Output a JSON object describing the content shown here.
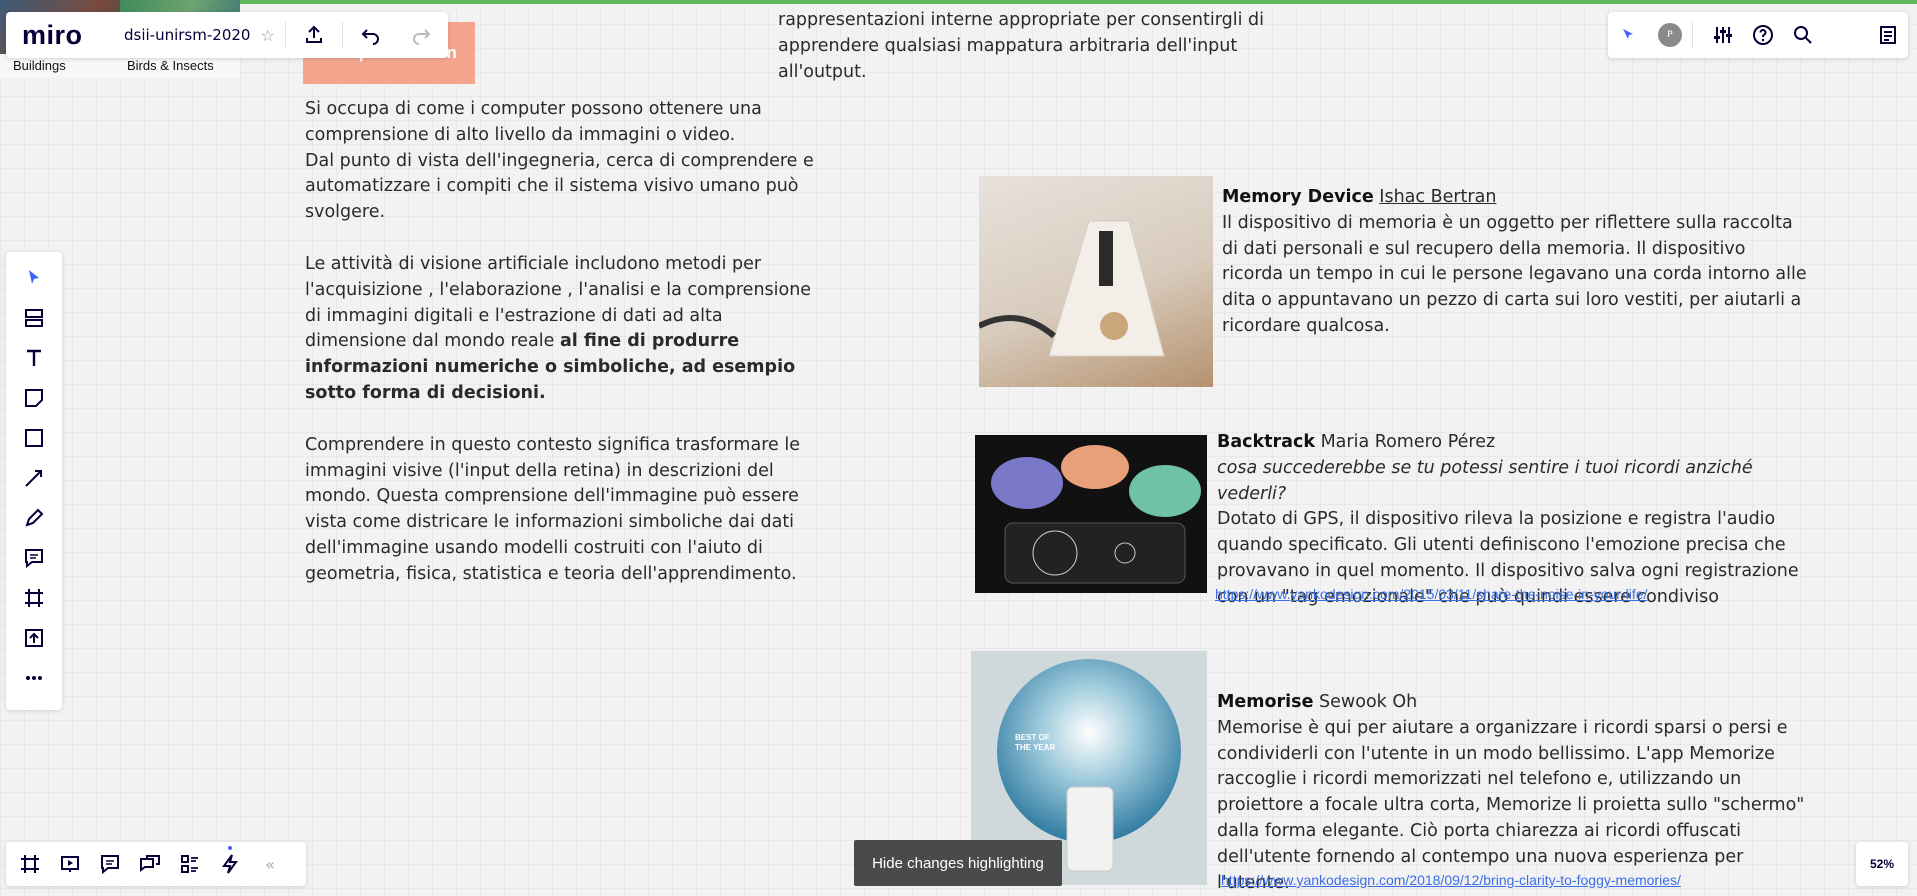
{
  "app": {
    "logo": "miro",
    "board_name": "dsii-unirsm-2020",
    "zoom": "52%"
  },
  "frames": [
    {
      "label": "Buildings"
    },
    {
      "label": "Birds & Insects"
    }
  ],
  "canvas": {
    "cv_label": "Computer Vision",
    "top_text": "rappresentazioni interne appropriate per consentirgli di apprendere qualsiasi mappatura arbitraria dell'input all'output.",
    "left_paragraphs": [
      "Si occupa di come i computer possono ottenere una comprensione di alto livello da immagini o video.\nDal punto di vista dell'ingegneria, cerca di comprendere e automatizzare i compiti che il sistema visivo umano può svolgere.",
      "Le attività di visione artificiale includono metodi per l'acquisizione , l'elaborazione , l'analisi e la comprensione di immagini digitali e l'estrazione di dati ad alta dimensione dal mondo reale ",
      "Comprendere in questo contesto significa trasformare le immagini visive (l'input della retina) in descrizioni del mondo. Questa comprensione dell'immagine può essere vista come districare le informazioni simboliche dai dati dell'immagine usando modelli costruiti con l'aiuto di geometria, fisica, statistica e teoria dell'apprendimento."
    ],
    "left_bold": "al fine di produrre informazioni numeriche o simboliche, ad esempio sotto forma di decisioni.",
    "items": [
      {
        "title": "Memory Device",
        "author": "Ishac Bertran",
        "description": "Il dispositivo di memoria è un oggetto per riflettere sulla raccolta di dati personali e sul recupero della memoria. Il dispositivo ricorda un tempo in cui le persone legavano una corda intorno alle dita o appuntavano un pezzo di carta sui loro vestiti, per aiutarli a ricordare qualcosa."
      },
      {
        "title": "Backtrack",
        "author": "Maria Romero Pérez",
        "subtitle": "cosa succederebbe se tu potessi sentire i tuoi ricordi anziché vederli?",
        "description": "Dotato di GPS, il dispositivo rileva la posizione e registra l'audio quando specificato. Gli utenti definiscono l'emozione precisa che provavano in quel momento. Il dispositivo salva ogni registrazione con un \"tag emozionale\" che può quindi essere condiviso",
        "url": "https://www.yankodesign.com/2015/03/11/share-the-noise-in-your-life/"
      },
      {
        "title": "Memorise",
        "author": "Sewook Oh",
        "description": "Memorise è qui per aiutare a organizzare i ricordi sparsi o persi e condividerli con l'utente in un modo bellissimo. L'app Memorize raccoglie i ricordi memorizzati nel telefono e, utilizzando un proiettore a focale ultra corta, Memorize li proietta sullo \"schermo\" dalla forma elegante. Ciò porta chiarezza ai ricordi offuscati dell'utente fornendo al contempo una nuova esperienza per l'utente.",
        "url": "https://www.yankodesign.com/2018/09/12/bring-clarity-to-foggy-memories/",
        "image_text": "BEST OF THE YEAR"
      }
    ]
  },
  "bottom": {
    "hide_changes": "Hide changes highlighting"
  },
  "user": {
    "avatar": "P"
  },
  "colors": {
    "accent": "#4262ff",
    "label_bg": "#f4a58e",
    "link": "#3a6ee8",
    "progress": "#5cb85c"
  }
}
